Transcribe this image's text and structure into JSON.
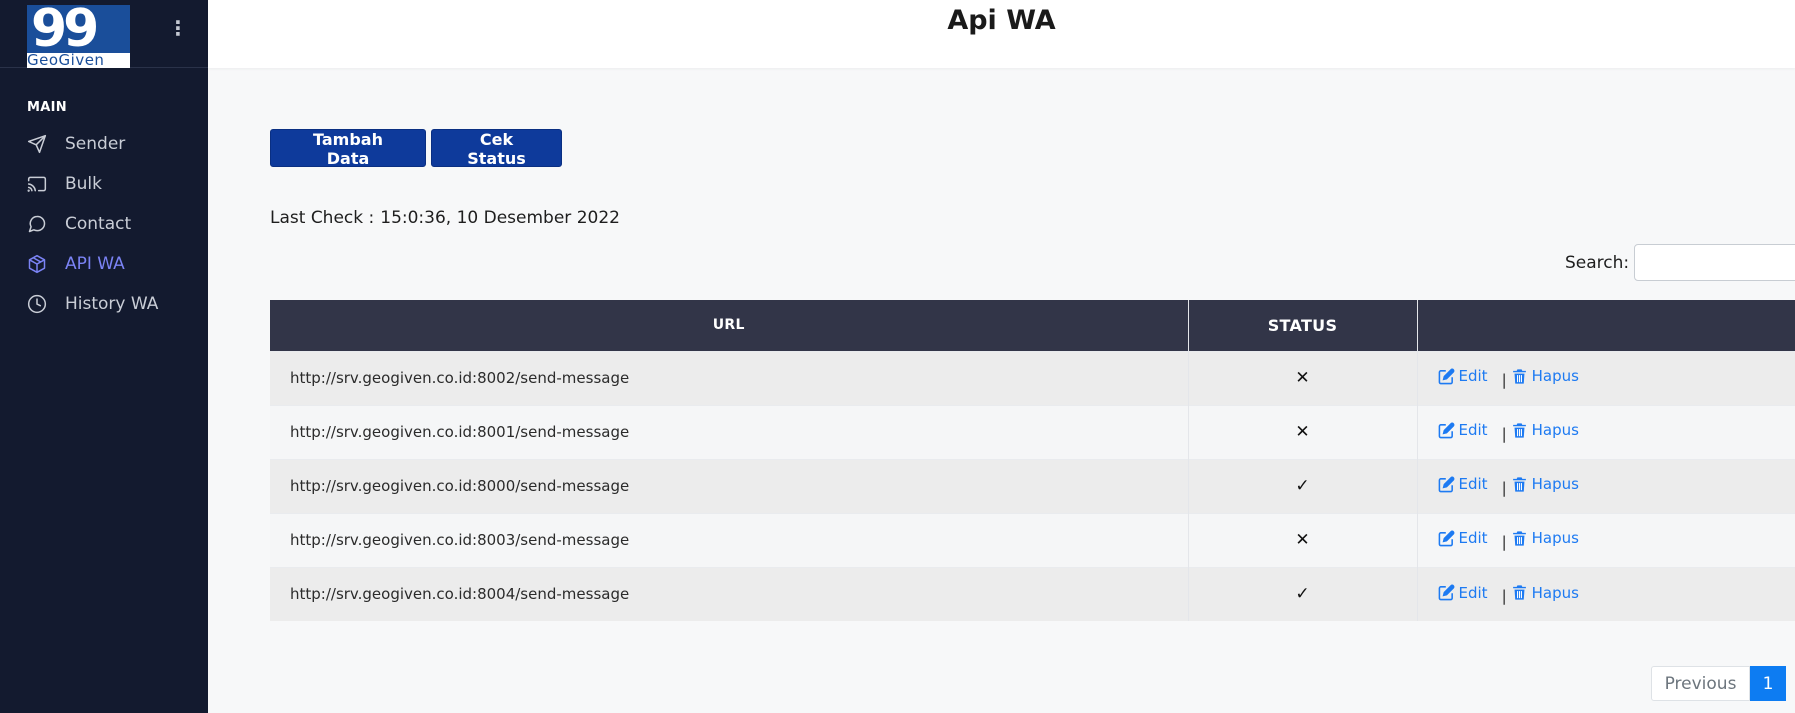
{
  "sidebar": {
    "logo_text": "GeoGiven",
    "section_title": "MAIN",
    "items": [
      {
        "label": "Sender",
        "icon": "send-icon"
      },
      {
        "label": "Bulk",
        "icon": "cast-icon"
      },
      {
        "label": "Contact",
        "icon": "message-circle-icon"
      },
      {
        "label": "API WA",
        "icon": "box-icon",
        "active": true
      },
      {
        "label": "History WA",
        "icon": "clock-icon"
      }
    ]
  },
  "header": {
    "title": "Api WA"
  },
  "toolbar": {
    "add_label": "Tambah Data",
    "check_label": "Cek Status"
  },
  "last_check": {
    "label": "Last Check :",
    "value": "15:0:36, 10 Desember 2022"
  },
  "search": {
    "label": "Search:",
    "value": "",
    "placeholder": ""
  },
  "table": {
    "columns": [
      "URL",
      "STATUS",
      ""
    ],
    "rows": [
      {
        "url": "http://srv.geogiven.co.id:8002/send-message",
        "status": "✕",
        "edit": "Edit",
        "delete": "Hapus"
      },
      {
        "url": "http://srv.geogiven.co.id:8001/send-message",
        "status": "✕",
        "edit": "Edit",
        "delete": "Hapus"
      },
      {
        "url": "http://srv.geogiven.co.id:8000/send-message",
        "status": "✓",
        "edit": "Edit",
        "delete": "Hapus"
      },
      {
        "url": "http://srv.geogiven.co.id:8003/send-message",
        "status": "✕",
        "edit": "Edit",
        "delete": "Hapus"
      },
      {
        "url": "http://srv.geogiven.co.id:8004/send-message",
        "status": "✓",
        "edit": "Edit",
        "delete": "Hapus"
      }
    ]
  },
  "pagination": {
    "previous": "Previous",
    "current": "1"
  },
  "colors": {
    "sidebar_bg": "#131a2f",
    "accent": "#0e3a9b",
    "active_nav": "#7b83f5",
    "link": "#1d7af2",
    "table_header": "#323548"
  }
}
